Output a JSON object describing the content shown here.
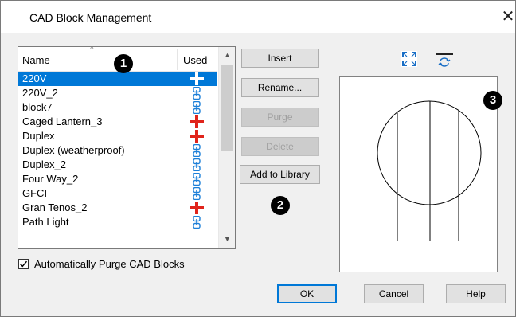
{
  "dialog": {
    "title": "CAD Block Management"
  },
  "list": {
    "columns": {
      "name": "Name",
      "used": "Used"
    },
    "rows": [
      {
        "name": "220V",
        "used": "used",
        "selected": true
      },
      {
        "name": "220V_2",
        "used": "unused",
        "selected": false
      },
      {
        "name": "block7",
        "used": "unused",
        "selected": false
      },
      {
        "name": "Caged Lantern_3",
        "used": "used",
        "selected": false
      },
      {
        "name": "Duplex",
        "used": "used",
        "selected": false
      },
      {
        "name": "Duplex (weatherproof)",
        "used": "unused",
        "selected": false
      },
      {
        "name": "Duplex_2",
        "used": "unused",
        "selected": false
      },
      {
        "name": "Four Way_2",
        "used": "unused",
        "selected": false
      },
      {
        "name": "GFCI",
        "used": "unused",
        "selected": false
      },
      {
        "name": "Gran Tenos_2",
        "used": "used",
        "selected": false
      },
      {
        "name": "Path Light",
        "used": "unused",
        "selected": false
      }
    ]
  },
  "buttons": {
    "insert": "Insert",
    "rename": "Rename...",
    "purge": "Purge",
    "delete": "Delete",
    "add_to_library": "Add to Library",
    "ok": "OK",
    "cancel": "Cancel",
    "help": "Help"
  },
  "options": {
    "auto_purge_label": "Automatically Purge CAD Blocks",
    "auto_purge_checked": true
  },
  "callouts": {
    "list": "1",
    "add_to_library": "2",
    "preview": "3"
  },
  "icons": {
    "fill_window": "fill-window-icon",
    "swap_orientation": "swap-view-icon",
    "used": "red-cross-icon",
    "unused": "blue-link-icon"
  },
  "colors": {
    "selection": "#0078d7",
    "used_marker": "#e0241b",
    "unused_marker": "#1c7fd8"
  }
}
